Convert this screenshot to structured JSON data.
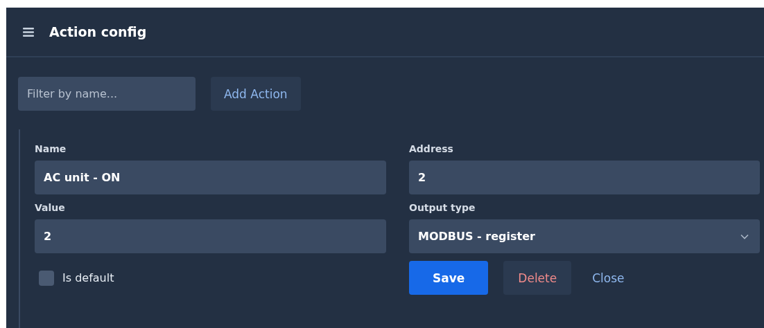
{
  "header": {
    "title": "Action config"
  },
  "toolbar": {
    "filter": {
      "placeholder": "Filter by name..."
    },
    "add_button": "Add Action"
  },
  "form": {
    "fields": [
      {
        "label": "Name",
        "value": "AC unit - ON",
        "kind": "text"
      },
      {
        "label": "Address",
        "value": "2",
        "kind": "text"
      },
      {
        "label": "Value",
        "value": "2",
        "kind": "text"
      },
      {
        "label": "Output type",
        "value": "MODBUS - register",
        "kind": "select"
      }
    ],
    "is_default": {
      "label": "Is default",
      "checked": false
    },
    "buttons": [
      {
        "label": "Save",
        "kind": "primary"
      },
      {
        "label": "Delete",
        "kind": "danger"
      },
      {
        "label": "Close",
        "kind": "link"
      }
    ]
  }
}
